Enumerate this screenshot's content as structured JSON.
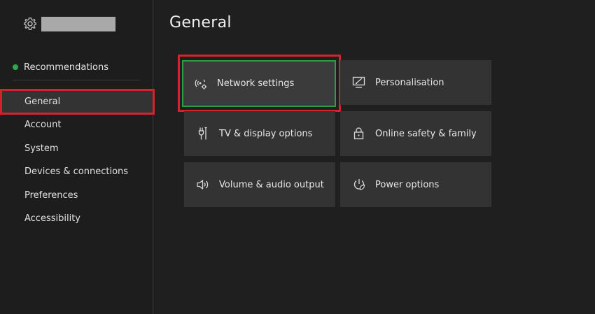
{
  "header": {
    "title": "General"
  },
  "sidebar": {
    "recommendations_label": "Recommendations",
    "items": [
      {
        "label": "General"
      },
      {
        "label": "Account"
      },
      {
        "label": "System"
      },
      {
        "label": "Devices & connections"
      },
      {
        "label": "Preferences"
      },
      {
        "label": "Accessibility"
      }
    ]
  },
  "tiles": [
    {
      "label": "Network settings",
      "icon": "network-icon"
    },
    {
      "label": "Personalisation",
      "icon": "personalisation-icon"
    },
    {
      "label": "TV & display options",
      "icon": "tv-display-icon"
    },
    {
      "label": "Online safety & family",
      "icon": "lock-icon"
    },
    {
      "label": "Volume & audio output",
      "icon": "speaker-icon"
    },
    {
      "label": "Power options",
      "icon": "power-icon"
    }
  ],
  "colors": {
    "accent_green": "#2e9d3f",
    "highlight_red": "#d6232b",
    "status_dot": "#2fa84f"
  }
}
